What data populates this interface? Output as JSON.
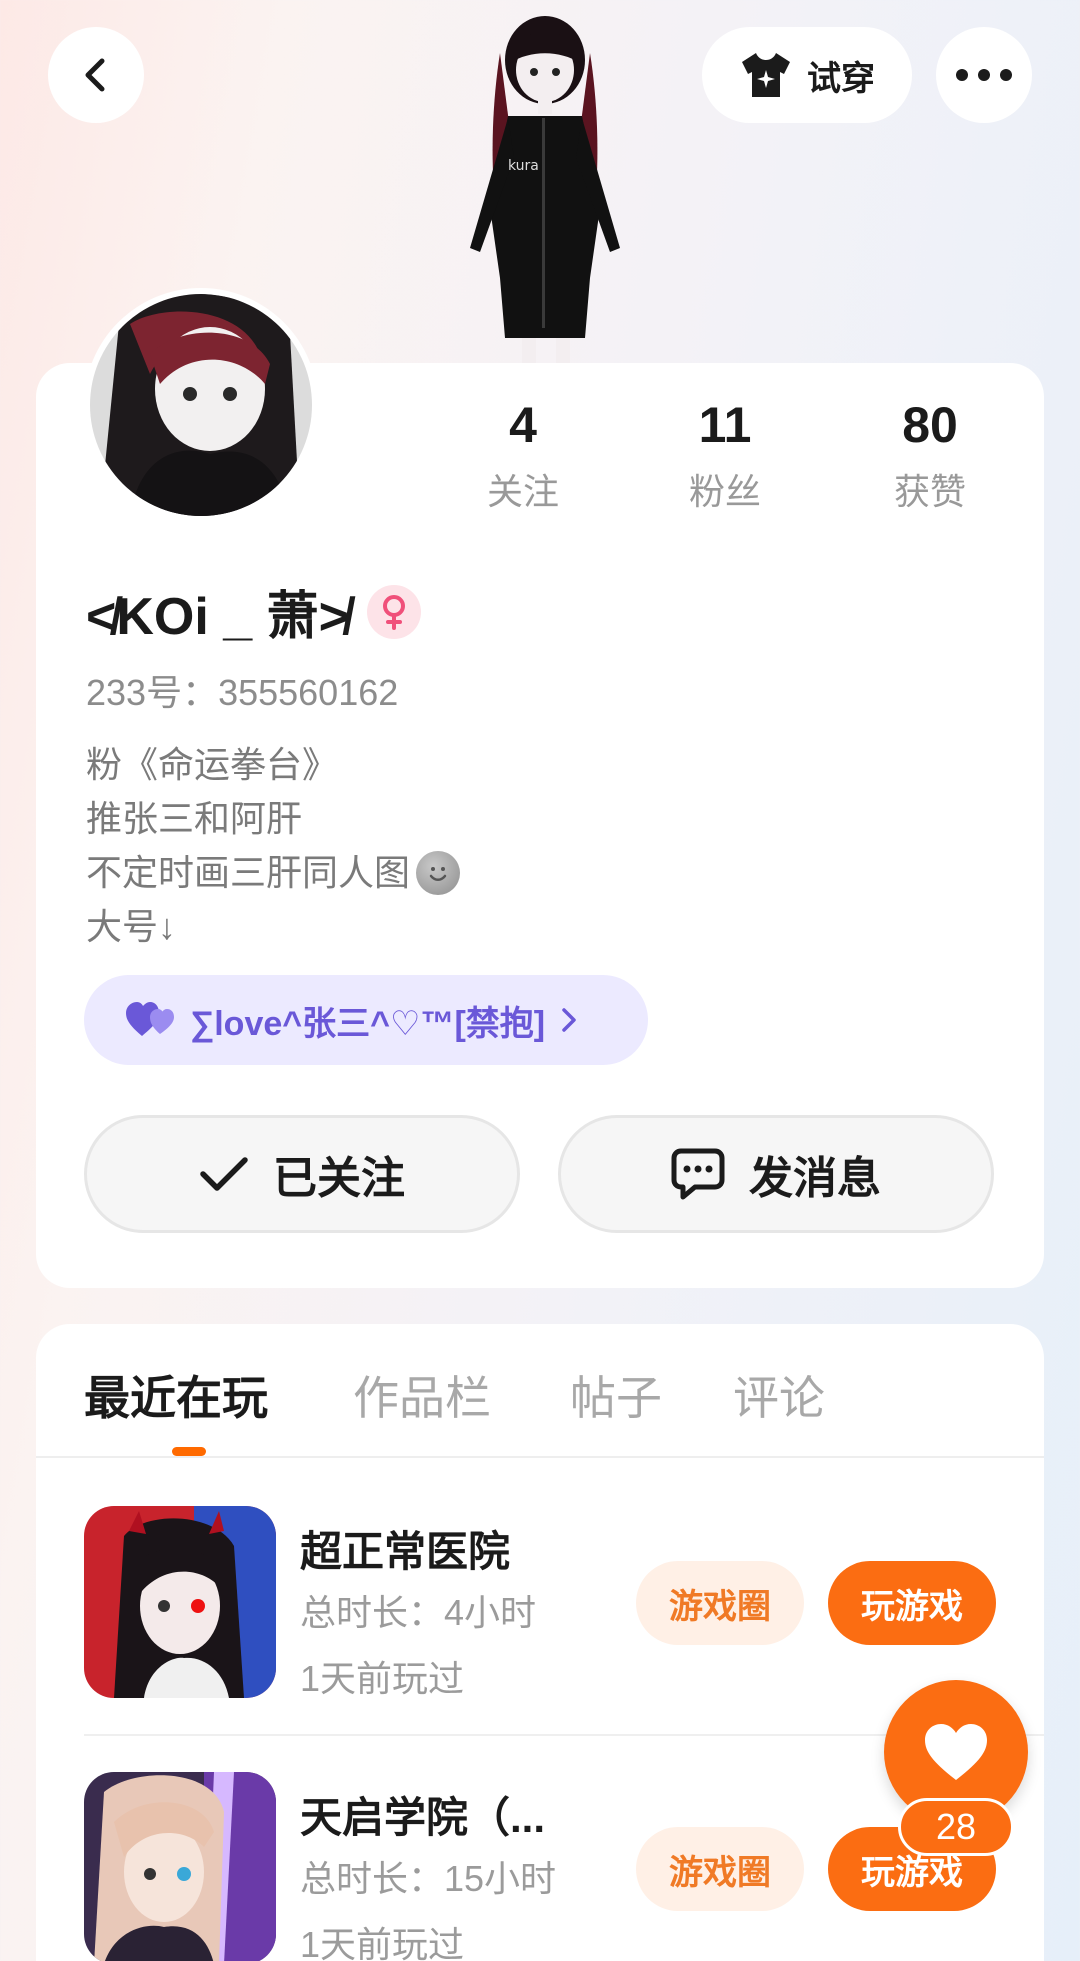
{
  "header": {
    "tryon_label": "试穿"
  },
  "profile": {
    "stats": [
      {
        "value": "4",
        "label": "关注"
      },
      {
        "value": "11",
        "label": "粉丝"
      },
      {
        "value": "80",
        "label": "获赞"
      }
    ],
    "username": "≮KOi _ 萧≯",
    "gender": "female",
    "uid": "233号：355560162",
    "bio": [
      "粉《命运拳台》",
      "推张三和阿肝",
      "不定时画三肝同人图",
      "大号↓"
    ],
    "badge": "∑love^张三^♡™[禁抱]",
    "follow_label": "已关注",
    "message_label": "发消息"
  },
  "tabs": [
    {
      "label": "最近在玩",
      "active": true
    },
    {
      "label": "作品栏",
      "active": false
    },
    {
      "label": "帖子",
      "active": false
    },
    {
      "label": "评论",
      "active": false
    }
  ],
  "games": [
    {
      "name": "超正常医院",
      "duration": "总时长：4小时",
      "last_played": "1天前玩过",
      "circle_label": "游戏圈",
      "play_label": "玩游戏"
    },
    {
      "name": "天启学院（...",
      "duration": "总时长：15小时",
      "last_played": "1天前玩过",
      "circle_label": "游戏圈",
      "play_label": "玩游戏"
    }
  ],
  "like": {
    "count": "28"
  },
  "colors": {
    "accent": "#fb6d12",
    "badge_text": "#6a58d8",
    "badge_bg": "#eceaff",
    "gender_pink": "#f0507a"
  }
}
